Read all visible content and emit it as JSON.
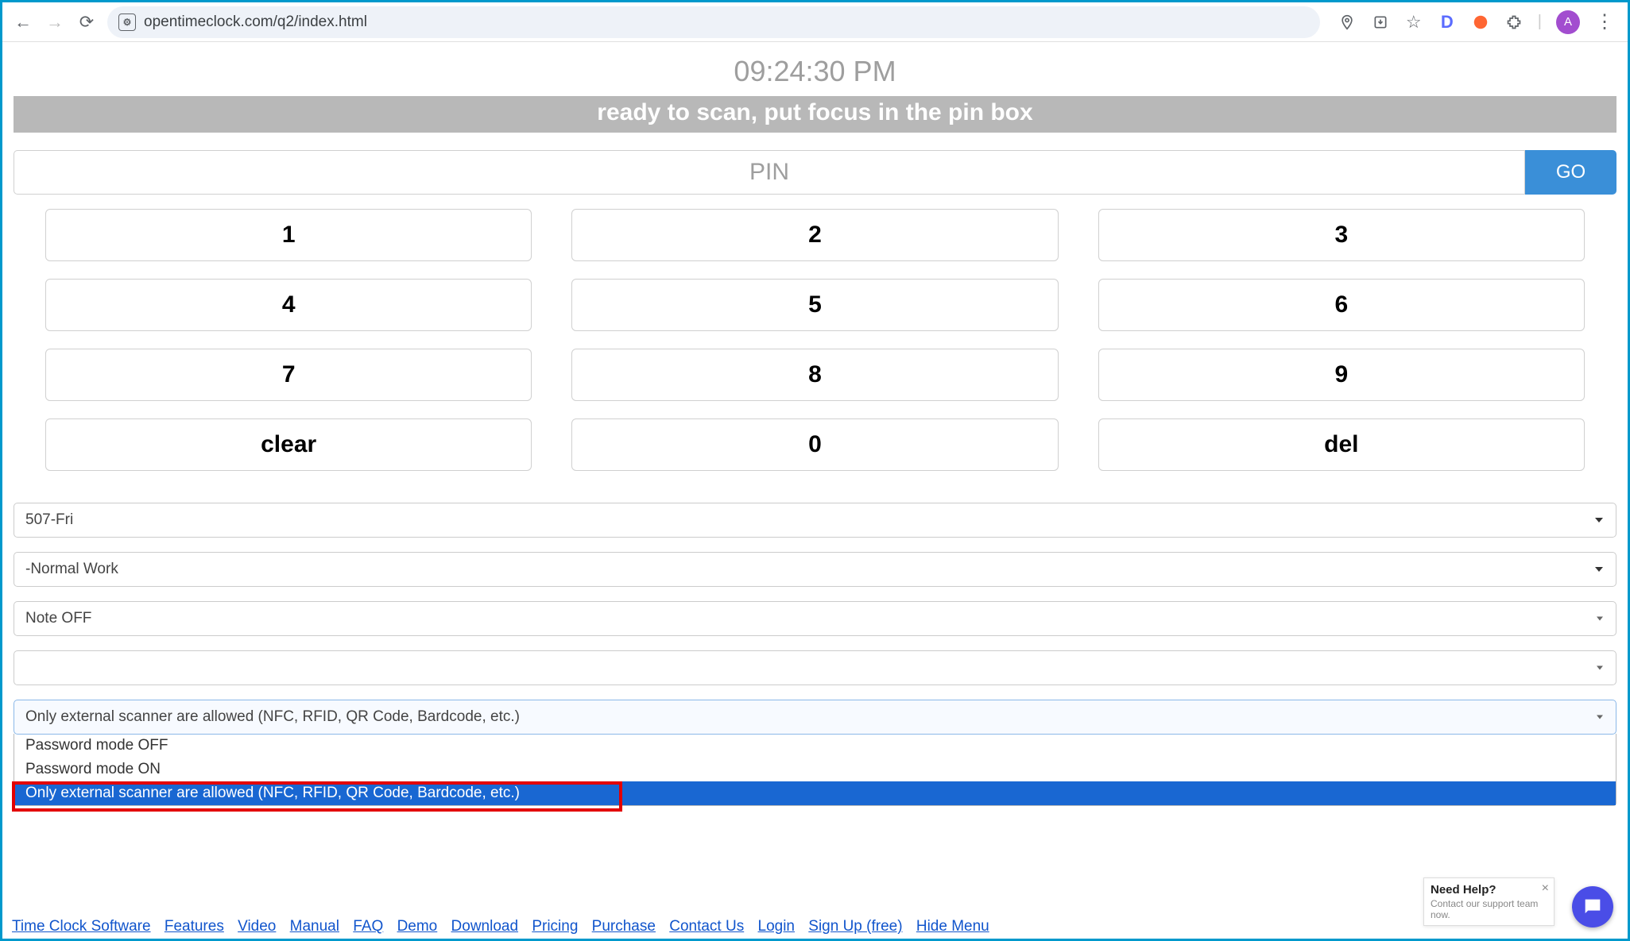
{
  "browser": {
    "url": "opentimeclock.com/q2/index.html",
    "ext_letter": "D",
    "avatar_letter": "A"
  },
  "time": "09:24:30 PM",
  "banner": "ready to scan, put focus in the pin box",
  "pin": {
    "placeholder": "PIN",
    "go": "GO"
  },
  "keypad": {
    "k1": "1",
    "k2": "2",
    "k3": "3",
    "k4": "4",
    "k5": "5",
    "k6": "6",
    "k7": "7",
    "k8": "8",
    "k9": "9",
    "clear": "clear",
    "k0": "0",
    "del": "del"
  },
  "selects": {
    "shift": "507-Fri",
    "worktype": "-Normal Work",
    "note": "Note OFF",
    "blank": "",
    "scanner_selected": "Only external scanner are allowed (NFC, RFID, QR Code, Bardcode, etc.)",
    "scanner_options": {
      "opt0": "Password mode OFF",
      "opt1": "Password mode ON",
      "opt2": "Only external scanner are allowed (NFC, RFID, QR Code, Bardcode, etc.)"
    }
  },
  "help": {
    "title": "Need Help?",
    "sub": "Contact our support team now."
  },
  "footer": {
    "l0": "Time Clock Software",
    "l1": "Features",
    "l2": "Video",
    "l3": "Manual",
    "l4": "FAQ",
    "l5": "Demo",
    "l6": "Download",
    "l7": "Pricing",
    "l8": "Purchase",
    "l9": "Contact Us",
    "l10": "Login",
    "l11": "Sign Up (free)",
    "l12": "Hide Menu"
  }
}
